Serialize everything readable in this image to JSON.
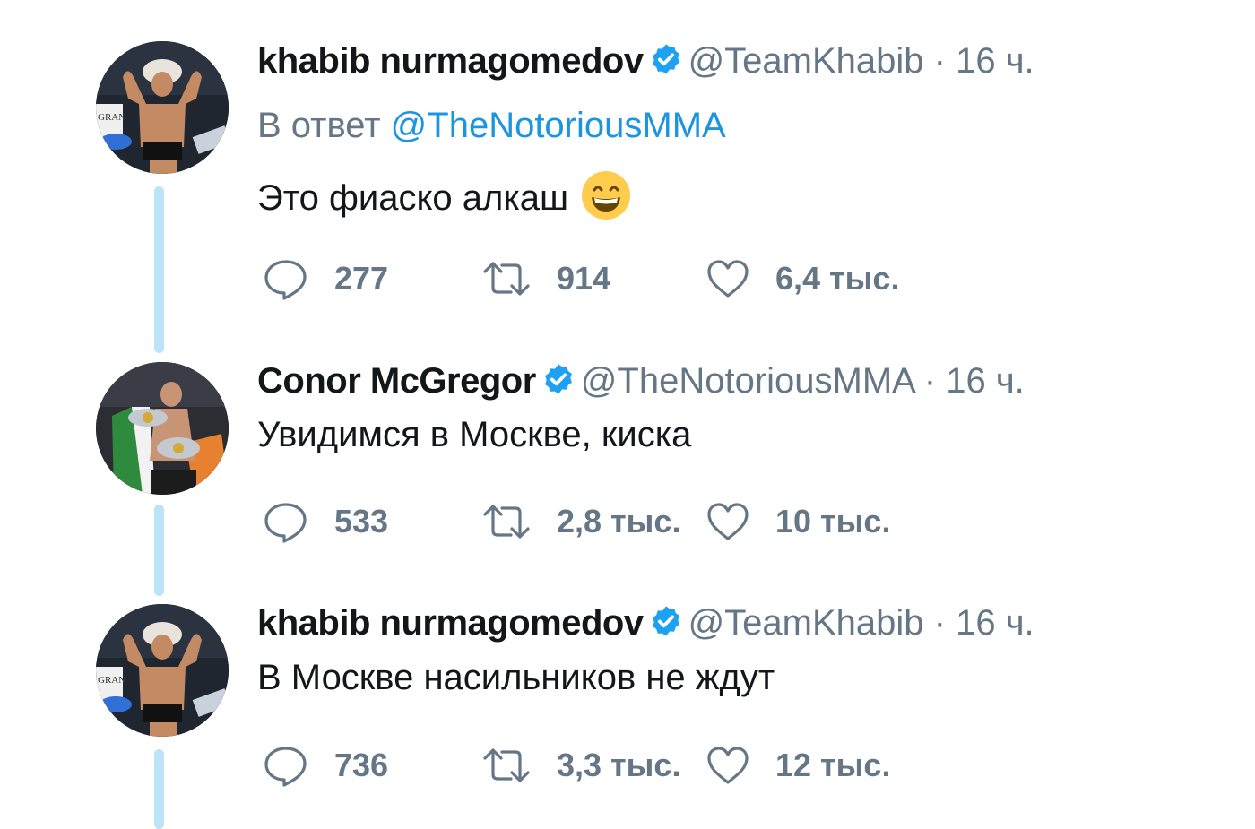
{
  "colors": {
    "name": "#14171a",
    "secondary": "#657786",
    "link": "#1b95e0",
    "verified": "#1da1f2",
    "thread_line": "#bde3f7"
  },
  "tweets": [
    {
      "name": "khabib nurmagomedov",
      "verified": true,
      "handle": "@TeamKhabib",
      "dot": "·",
      "time": "16 ч.",
      "reply_prefix": "В ответ",
      "reply_mention": "@TheNotoriousMMA",
      "text": "Это фиаско алкаш",
      "emoji": "grinning-face-icon",
      "replies": "277",
      "retweets": "914",
      "likes": "6,4 тыс."
    },
    {
      "name": "Conor McGregor",
      "verified": true,
      "handle": "@TheNotoriousMMA",
      "dot": "·",
      "time": "16 ч.",
      "text": "Увидимся в Москве, киска",
      "replies": "533",
      "retweets": "2,8 тыс.",
      "likes": "10 тыс."
    },
    {
      "name": "khabib nurmagomedov",
      "verified": true,
      "handle": "@TeamKhabib",
      "dot": "·",
      "time": "16 ч.",
      "text": "В Москве насильников не ждут",
      "replies": "736",
      "retweets": "3,3 тыс.",
      "likes": "12 тыс."
    }
  ]
}
